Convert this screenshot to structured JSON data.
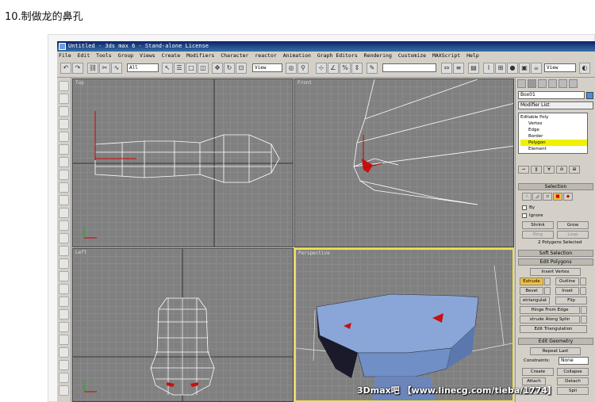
{
  "heading": "10.制做龙的鼻孔",
  "window": {
    "title": "Untitled - 3ds max 6 - Stand-alone License"
  },
  "menu": [
    "File",
    "Edit",
    "Tools",
    "Group",
    "Views",
    "Create",
    "Modifiers",
    "Character",
    "reactor",
    "Animation",
    "Graph Editors",
    "Rendering",
    "Customize",
    "MAXScript",
    "Help"
  ],
  "toolbar": {
    "selection_filter": "All",
    "ref_coord": "View",
    "named_sel": "",
    "view_right": "View"
  },
  "viewports": {
    "top": "Top",
    "front": "Front",
    "left": "Left",
    "perspective": "Perspective"
  },
  "command_panel": {
    "object_name": "Box01",
    "modifier_list": "Modifier List",
    "stack": [
      "Editable Poly",
      "Vertex",
      "Edge",
      "Border",
      "Polygon",
      "Element"
    ],
    "selected_level": "Polygon",
    "selection": {
      "title": "Selection",
      "by": "By",
      "ignore": "Ignore",
      "shrink": "Shrink",
      "grow": "Grow",
      "ring": "Ring",
      "loop": "Loop",
      "status": "2 Polygons Selected"
    },
    "soft_selection": "Soft Selection",
    "edit_polygons": {
      "title": "Edit Polygons",
      "insert_vertex": "Insert Vertex",
      "extrude": "Extrude",
      "outline": "Outline",
      "bevel": "Bevel",
      "inset": "Inset",
      "retriangulate": "etriangulat",
      "flip": "Flip",
      "hinge": "Hinge From Edge",
      "extrude_spline": "xtrude Along Splin",
      "edit_tri": "Edit Triangulation"
    },
    "edit_geometry": {
      "title": "Edit Geometry",
      "repeat_last": "Repeat Last",
      "constraints_label": "Constraints:",
      "constraints_value": "None",
      "create": "Create",
      "collapse": "Collapse",
      "attach": "Attach",
      "detach": "Detach",
      "slice_plane": "lice Plan",
      "split": "Spli"
    }
  },
  "watermark": "3Dmax吧 【www.linecg.com/tieba/1774】",
  "colors": {
    "selected_face": "#c81010",
    "mesh_blue": "#8aa6d8",
    "active_border": "#f0e040"
  }
}
